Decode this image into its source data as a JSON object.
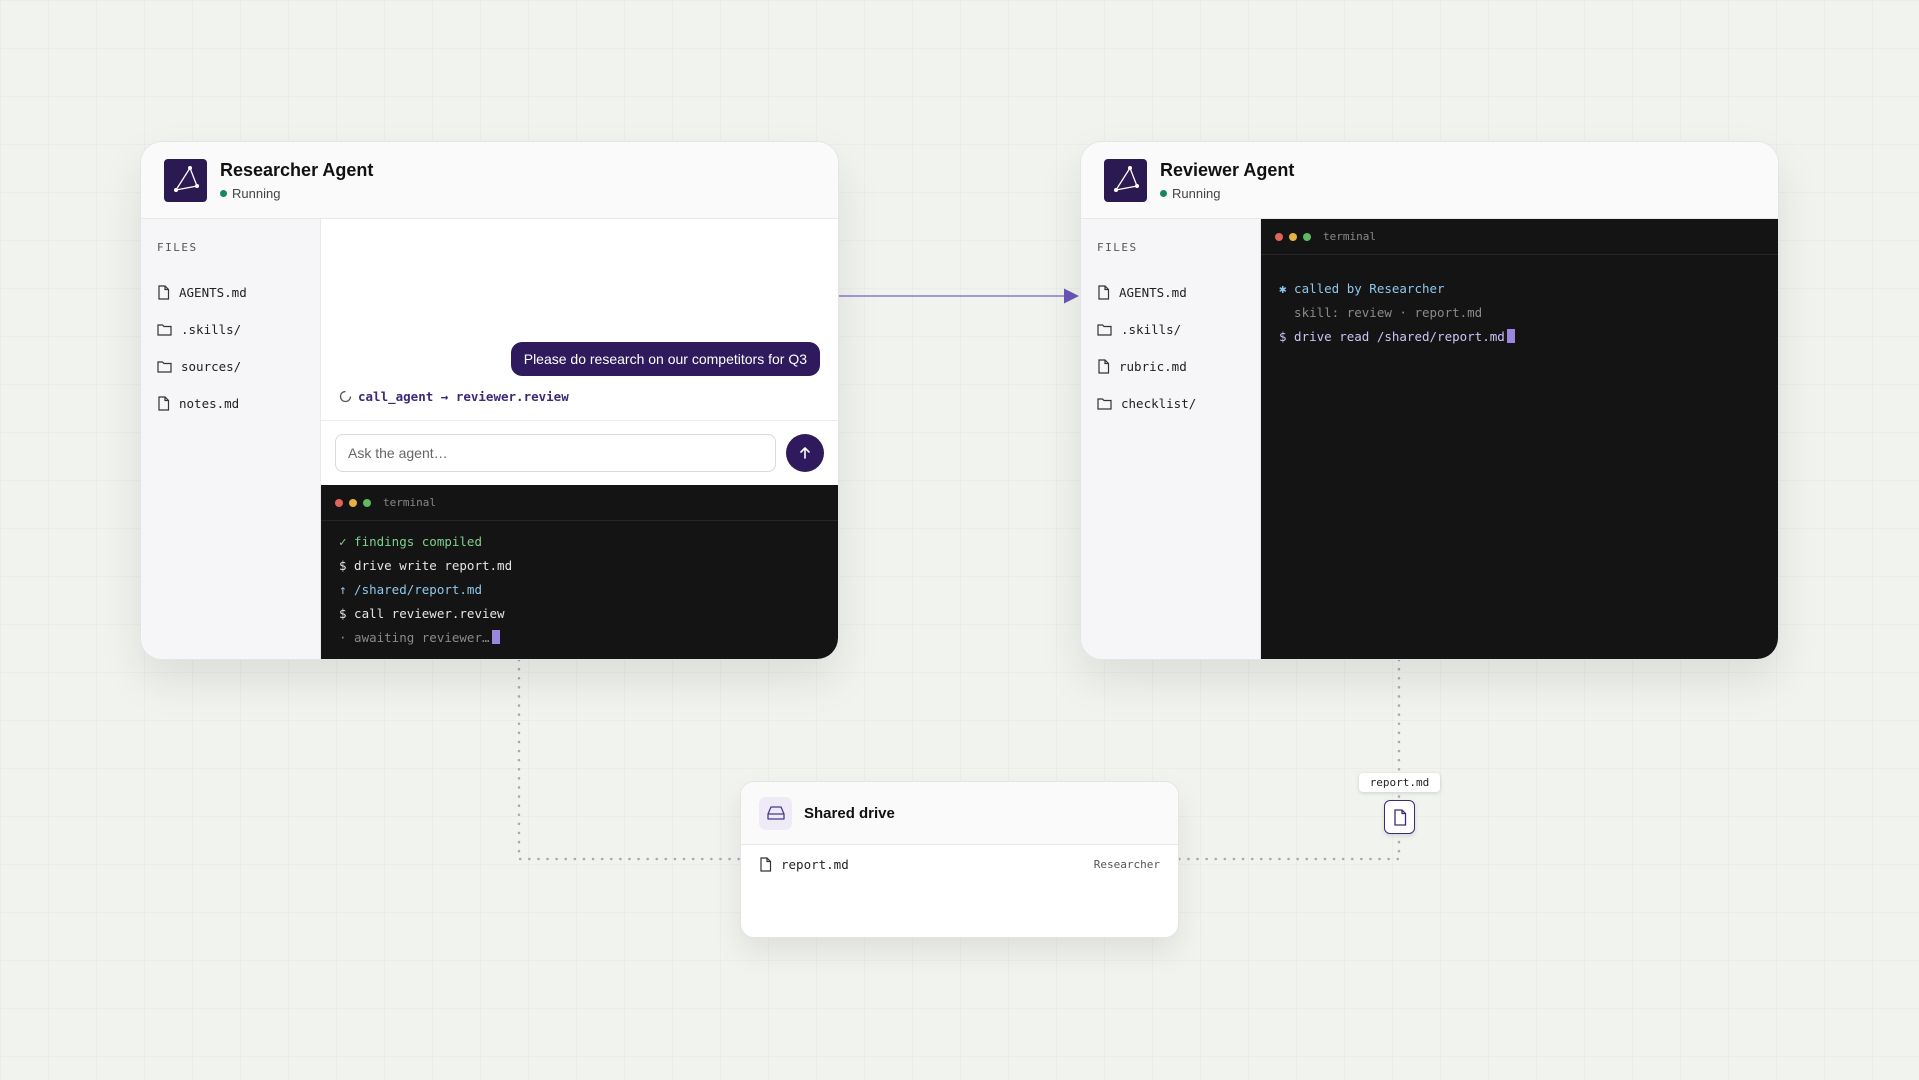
{
  "colors": {
    "accent": "#2e1a5c",
    "running": "#16865b",
    "terminal_bg": "#141414"
  },
  "researcher": {
    "title": "Researcher Agent",
    "status": "Running",
    "files_heading": "FILES",
    "files": [
      {
        "name": "AGENTS.md",
        "icon": "file-icon"
      },
      {
        "name": ".skills/",
        "icon": "folder-icon"
      },
      {
        "name": "sources/",
        "icon": "folder-icon"
      },
      {
        "name": "notes.md",
        "icon": "file-icon"
      }
    ],
    "chat": {
      "user_message": "Please do research on our competitors for Q3",
      "tool_call": "call_agent → reviewer.review"
    },
    "input_placeholder": "Ask the agent…",
    "terminal": {
      "title": "terminal",
      "lines": [
        "✓ findings compiled",
        "$ drive write report.md",
        "↑ /shared/report.md",
        "$ call reviewer.review",
        "· awaiting reviewer…"
      ]
    }
  },
  "reviewer": {
    "title": "Reviewer Agent",
    "status": "Running",
    "files_heading": "FILES",
    "files": [
      {
        "name": "AGENTS.md",
        "icon": "file-icon"
      },
      {
        "name": ".skills/",
        "icon": "folder-icon"
      },
      {
        "name": "rubric.md",
        "icon": "file-icon"
      },
      {
        "name": "checklist/",
        "icon": "folder-icon"
      }
    ],
    "terminal": {
      "title": "terminal",
      "lines": [
        "✱ called by Researcher",
        "  skill: review · report.md",
        "$ drive read /shared/report.md"
      ]
    }
  },
  "shared_drive": {
    "title": "Shared drive",
    "files": [
      {
        "name": "report.md",
        "owner": "Researcher"
      }
    ]
  },
  "transfer": {
    "label": "report.md"
  }
}
